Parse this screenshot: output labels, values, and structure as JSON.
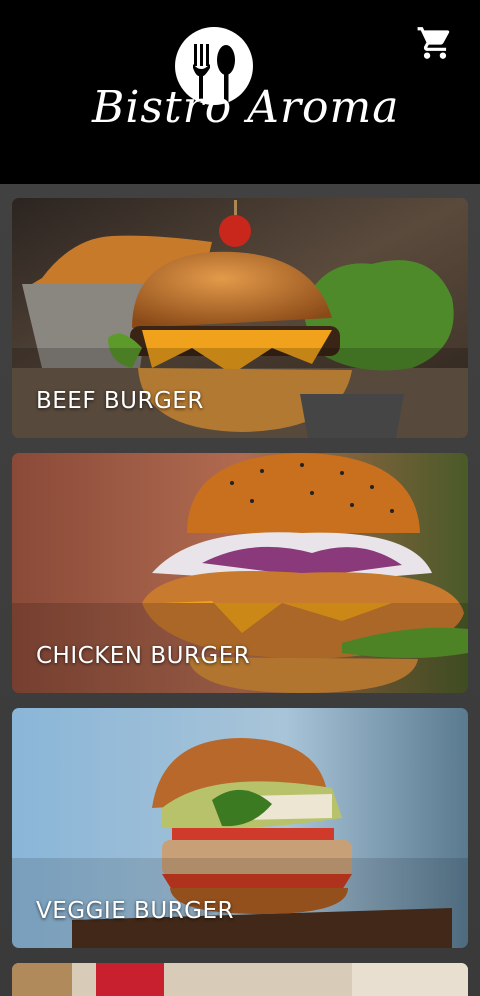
{
  "header": {
    "brand": "Bistro Aroma",
    "cart_icon": "cart-icon",
    "logo_icon": "fork-spoon-icon"
  },
  "menu": {
    "items": [
      {
        "label": "BEEF BURGER"
      },
      {
        "label": "CHICKEN BURGER"
      },
      {
        "label": "VEGGIE BURGER"
      },
      {
        "label": ""
      }
    ]
  },
  "colors": {
    "header_bg": "#000000",
    "page_bg": "#3a3a3a",
    "text": "#ffffff"
  }
}
